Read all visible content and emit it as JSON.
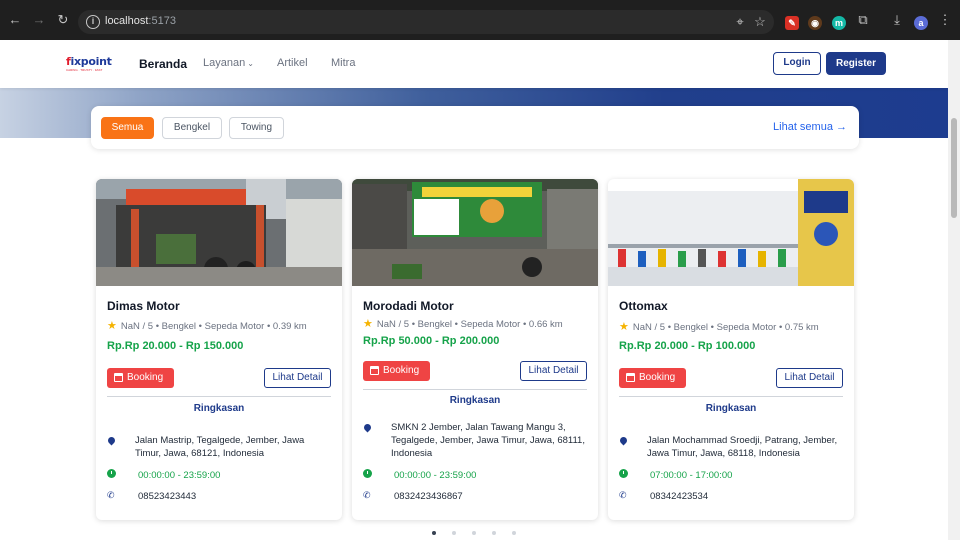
{
  "browser": {
    "url_host": "localhost",
    "url_port": ":5173",
    "profile_initial": "a"
  },
  "navbar": {
    "logo_text_main": "ixpoint",
    "logo_text_f": "f",
    "logo_tagline": "CARING · TRUSTY · FAST",
    "items": [
      {
        "label": "Beranda"
      },
      {
        "label": "Layanan"
      },
      {
        "label": "Artikel"
      },
      {
        "label": "Mitra"
      }
    ],
    "login_label": "Login",
    "register_label": "Register"
  },
  "filters": {
    "chips": [
      {
        "label": "Semua"
      },
      {
        "label": "Bengkel"
      },
      {
        "label": "Towing"
      }
    ],
    "see_all": "Lihat semua →"
  },
  "cards": [
    {
      "name": "Dimas Motor",
      "meta": "NaN / 5 • Bengkel • Sepeda Motor • 0.39 km",
      "price": "Rp.Rp 20.000 - Rp 150.000",
      "booking": "Booking",
      "detail": "Lihat Detail",
      "summary": "Ringkasan",
      "address": "Jalan Mastrip, Tegalgede, Jember, Jawa Timur, Jawa, 68121, Indonesia",
      "hours": "00:00:00 - 23:59:00",
      "phone": "08523423443"
    },
    {
      "name": "Morodadi Motor",
      "meta": "NaN / 5 • Bengkel • Sepeda Motor • 0.66 km",
      "price": "Rp.Rp 50.000 - Rp 200.000",
      "booking": "Booking",
      "detail": "Lihat Detail",
      "summary": "Ringkasan",
      "address": "SMKN 2 Jember, Jalan Tawang Mangu 3, Tegalgede, Jember, Jawa Timur, Jawa, 68111, Indonesia",
      "hours": "00:00:00 - 23:59:00",
      "phone": "0832423436867"
    },
    {
      "name": "Ottomax",
      "meta": "NaN / 5 • Bengkel • Sepeda Motor • 0.75 km",
      "price": "Rp.Rp 20.000 - Rp 100.000",
      "booking": "Booking",
      "detail": "Lihat Detail",
      "summary": "Ringkasan",
      "address": "Jalan Mochammad Sroedji, Patrang, Jember, Jawa Timur, Jawa, 68118, Indonesia",
      "hours": "07:00:00 - 17:00:00",
      "phone": "08342423534"
    }
  ],
  "carousel": {
    "total_pages": 5,
    "active_page": 1
  },
  "colors": {
    "primary": "#1e3a8a",
    "accent": "#f97316",
    "booking": "#ef4444",
    "price": "#16a34a"
  }
}
